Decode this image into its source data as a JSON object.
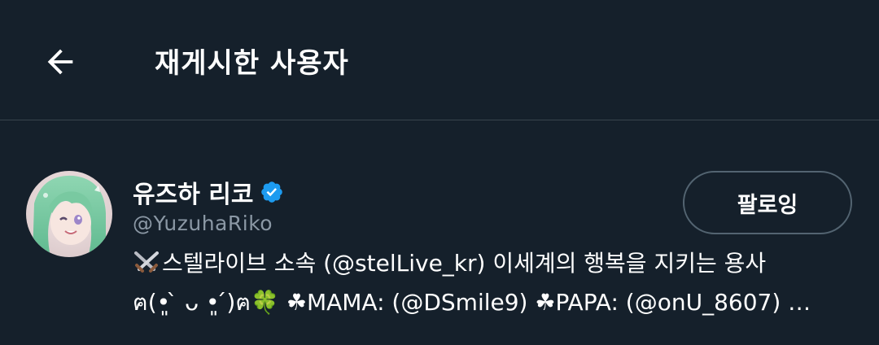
{
  "header": {
    "back_icon": "arrow-left-icon",
    "title": "재게시한 사용자"
  },
  "user": {
    "display_name": "유즈하 리코",
    "verified": true,
    "verified_color": "#1d9bf0",
    "handle": "@YuzuhaRiko",
    "follow_label": "팔로잉",
    "bio_line_1": "스텔라이브 소속 (@stelLive_kr) 이세계의 행복을 지키는 용사",
    "bio_line_2": "ฅ(•͈ ̀ ᴗ •͈ ́)ฅ🍀 ☘MAMA: (@DSmile9) ☘PAPA: (@onU_8607) …"
  },
  "colors": {
    "background": "#15202b",
    "secondary_text": "#8b98a5",
    "divider": "#38444d"
  }
}
